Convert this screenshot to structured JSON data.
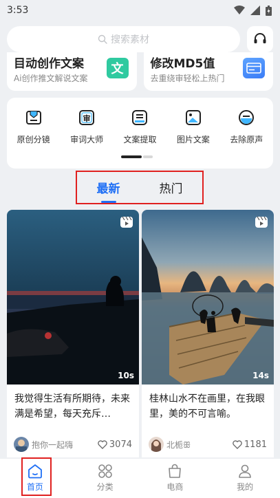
{
  "status_bar": {
    "time": "3:53"
  },
  "search": {
    "placeholder": "搜索素材"
  },
  "feature_cards": [
    {
      "title": "目动创作文案",
      "subtitle": "Ai创作推文解说文案",
      "icon": "wen-icon",
      "icon_text": "文"
    },
    {
      "title": "修改MD5值",
      "subtitle": "去重绕审轻松上热门",
      "icon": "card-icon"
    }
  ],
  "tools": [
    {
      "label": "原创分镜",
      "icon": "storyboard-icon"
    },
    {
      "label": "审词大师",
      "icon": "review-words-icon",
      "icon_text": "审"
    },
    {
      "label": "文案提取",
      "icon": "text-extract-icon"
    },
    {
      "label": "图片文案",
      "icon": "image-text-icon"
    },
    {
      "label": "去除原声",
      "icon": "remove-audio-icon"
    }
  ],
  "feed_tabs": {
    "latest": "最新",
    "hot": "热门",
    "active": "latest"
  },
  "cards": [
    {
      "title": "我觉得生活有所期待，未来满是希望，每天充斥…",
      "duration": "10s",
      "author": "抱你一起嗨",
      "likes": "3074"
    },
    {
      "title": "桂林山水不在画里，在我眼里，美的不可言喻。",
      "duration": "14s",
      "author": "北栀ꕥ",
      "likes": "1181"
    }
  ],
  "bottom_nav": [
    {
      "label": "首页",
      "icon": "home-icon",
      "active": true
    },
    {
      "label": "分类",
      "icon": "category-icon",
      "active": false
    },
    {
      "label": "电商",
      "icon": "shopping-bag-icon",
      "active": false
    },
    {
      "label": "我的",
      "icon": "profile-icon",
      "active": false
    }
  ],
  "colors": {
    "accent": "#1f6ff5",
    "highlight_box": "#e0201f",
    "background": "#eef0f3"
  }
}
